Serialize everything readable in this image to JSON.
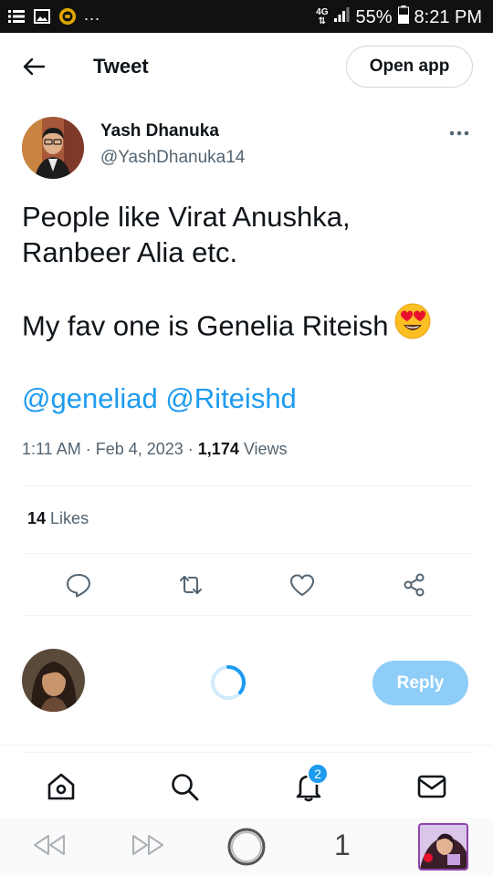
{
  "status_bar": {
    "battery": "55%",
    "time": "8:21 PM",
    "network": "4G",
    "overflow": "..."
  },
  "header": {
    "title": "Tweet",
    "open_app_label": "Open app"
  },
  "author": {
    "name": "Yash Dhanuka",
    "handle": "@YashDhanuka14"
  },
  "tweet": {
    "line1": "People like Virat Anushka,",
    "line2": "Ranbeer Alia etc.",
    "line3": "My fav one is Genelia Riteish",
    "emoji": "heart-eyes-emoji",
    "mention1": "@geneliad",
    "mention2": "@Riteishd"
  },
  "meta": {
    "time": "1:11 AM",
    "date": "Feb 4, 2023",
    "views_count": "1,174",
    "views_label": "Views"
  },
  "likes": {
    "count": "14",
    "label": "Likes"
  },
  "actions": [
    "reply-icon",
    "retweet-icon",
    "like-icon",
    "share-icon"
  ],
  "reply_bar": {
    "reply_label": "Reply"
  },
  "bottom_nav": {
    "items": [
      "home-icon",
      "search-icon",
      "notifications-icon",
      "messages-icon"
    ],
    "notification_badge": "2"
  },
  "browser_bar": {
    "tab_count": "1"
  },
  "colors": {
    "accent": "#1d9bf0",
    "reply_disabled": "#8ecdf8",
    "secondary_text": "#536471"
  }
}
